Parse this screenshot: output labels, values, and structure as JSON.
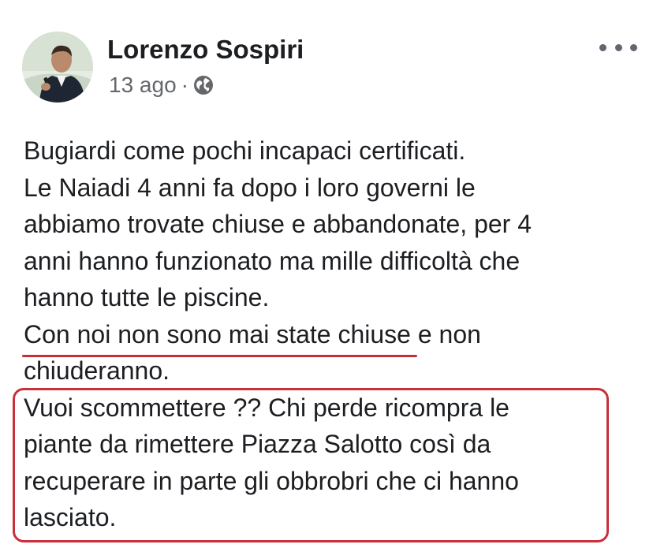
{
  "post": {
    "author": "Lorenzo Sospiri",
    "timestamp": "13 ago",
    "separator": "·",
    "audience_icon": "globe-icon",
    "more_icon": "more-options-icon",
    "body": {
      "lines": [
        "Bugiardi come pochi incapaci certificati.",
        "Le Naiadi 4 anni fa dopo i loro governi le",
        "abbiamo trovate chiuse e abbandonate, per 4",
        "anni hanno funzionato ma mille difficoltà che",
        "hanno tutte le piscine."
      ],
      "underlined_text": "Con noi non sono mai state chiuse",
      "underlined_tail": " e non",
      "line_after_underline": "chiuderanno.",
      "boxed_lines": [
        "Vuoi scommettere ?? Chi perde ricompra le",
        "piante da rimettere Piazza Salotto così da",
        "recuperare in parte gli obbrobri che ci hanno",
        "lasciato."
      ]
    }
  },
  "annotations": {
    "underline_color": "#c62f36",
    "box_color": "#c93039"
  }
}
